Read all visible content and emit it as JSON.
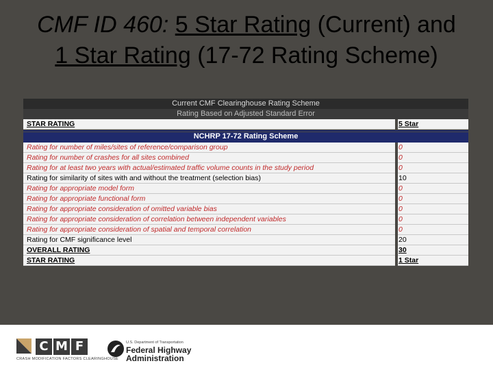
{
  "title": {
    "prefix": "CMF ID 460:",
    "current_link": "5 Star Rating",
    "current_tail": " (Current) and",
    "new_link": "1 Star Rating",
    "new_tail": " (17-72 Rating Scheme)"
  },
  "current_scheme": {
    "header": "Current CMF Clearinghouse Rating Scheme",
    "subheader": "Rating Based on Adjusted Standard Error",
    "star_label": "STAR RATING",
    "star_value": "5 Star"
  },
  "nchrp_scheme": {
    "header": "NCHRP 17-72 Rating Scheme",
    "rows": [
      {
        "label": "Rating for number of miles/sites of reference/comparison group",
        "value": "0",
        "style": "red"
      },
      {
        "label": "Rating for number of crashes for all sites combined",
        "value": "0",
        "style": "red"
      },
      {
        "label": "Rating for at least two years with actual/estimated traffic volume counts in the study period",
        "value": "0",
        "style": "red"
      },
      {
        "label": "Rating for similarity of sites with and without the treatment (selection bias)",
        "value": "10",
        "style": "blk"
      },
      {
        "label": "Rating for appropriate model form",
        "value": "0",
        "style": "red"
      },
      {
        "label": "Rating for appropriate functional form",
        "value": "0",
        "style": "red"
      },
      {
        "label": "Rating for appropriate consideration of omitted variable bias",
        "value": "0",
        "style": "red"
      },
      {
        "label": "Rating for appropriate consideration of correlation between independent variables",
        "value": "0",
        "style": "red"
      },
      {
        "label": "Rating for appropriate consideration of spatial and temporal correlation",
        "value": "0",
        "style": "red"
      },
      {
        "label": "Rating for CMF significance level",
        "value": "20",
        "style": "blk"
      },
      {
        "label": "OVERALL RATING",
        "value": "30",
        "style": "bold"
      },
      {
        "label": "STAR RATING",
        "value": "1 Star",
        "style": "bold"
      }
    ]
  },
  "footer": {
    "cmf_letters": [
      "C",
      "M",
      "F"
    ],
    "cmf_subtitle": "CRASH MODIFICATION FACTORS CLEARINGHOUSE",
    "dot_line": "U.S. Department of Transportation",
    "fhwa_line1": "Federal Highway",
    "fhwa_line2": "Administration"
  },
  "colors": {
    "background": "#4a4844",
    "navy": "#1f2a6b",
    "red_text": "#c0292a"
  }
}
